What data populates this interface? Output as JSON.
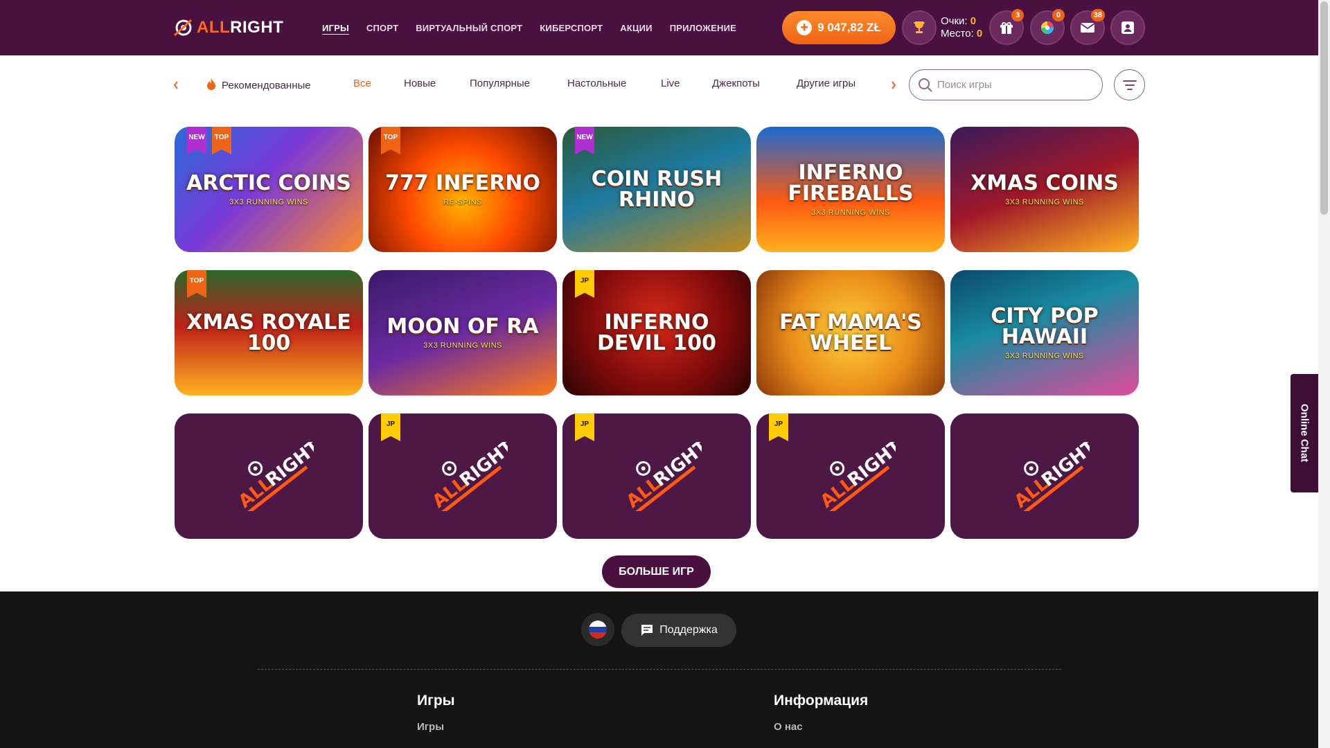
{
  "header": {
    "logo": {
      "part1": "ALL",
      "part2": "RIGHT"
    },
    "nav": [
      "ИГРЫ",
      "СПОРТ",
      "ВИРТУАЛЬНЫЙ СПОРТ",
      "КИБЕРСПОРТ",
      "АКЦИИ",
      "ПРИЛОЖЕНИЕ"
    ],
    "balance": "9 047,82 ZŁ",
    "points_label": "Очки:",
    "points_value": "0",
    "place_label": "Место:",
    "place_value": "0",
    "badges": {
      "gifts": "3",
      "wheel": "0",
      "messages": "38"
    }
  },
  "categories": {
    "items": [
      "Рекомендованные",
      "Все",
      "Новые",
      "Популярные",
      "Настольные",
      "Live",
      "Джекпоты",
      "Другие игры"
    ],
    "active": "Все",
    "search_placeholder": "Поиск игры"
  },
  "games": [
    {
      "title": "Arctic Coins",
      "subtitle": "3X3 RUNNING WINS",
      "tags": [
        "NEW",
        "TOP"
      ]
    },
    {
      "title": "777 Inferno",
      "subtitle": "RE-SPINS",
      "tags": [
        "TOP"
      ]
    },
    {
      "title": "Coin Rush Rhino",
      "subtitle": "",
      "tags": [
        "NEW"
      ]
    },
    {
      "title": "Inferno Fireballs",
      "subtitle": "3X3 RUNNING WINS",
      "tags": []
    },
    {
      "title": "Xmas Coins",
      "subtitle": "3X3 RUNNING WINS",
      "tags": []
    },
    {
      "title": "Xmas Royale 100",
      "subtitle": "",
      "tags": [
        "TOP"
      ]
    },
    {
      "title": "Moon of Ra",
      "subtitle": "3X3 RUNNING WINS",
      "tags": []
    },
    {
      "title": "Inferno Devil 100",
      "subtitle": "",
      "tags": [
        "JP"
      ]
    },
    {
      "title": "Fat Mama's Wheel",
      "subtitle": "",
      "tags": []
    },
    {
      "title": "City Pop Hawaii",
      "subtitle": "3X3 RUNNING WINS",
      "tags": []
    },
    {
      "title": "ALLRIGHT",
      "subtitle": "",
      "tags": []
    },
    {
      "title": "ALLRIGHT",
      "subtitle": "",
      "tags": [
        "JP"
      ]
    },
    {
      "title": "ALLRIGHT",
      "subtitle": "",
      "tags": [
        "JP"
      ]
    },
    {
      "title": "ALLRIGHT",
      "subtitle": "",
      "tags": [
        "JP"
      ]
    },
    {
      "title": "ALLRIGHT",
      "subtitle": "",
      "tags": []
    }
  ],
  "more_button": "БОЛЬШЕ ИГР",
  "footer": {
    "support": "Поддержка",
    "col1_title": "Игры",
    "col1_link": "Игры",
    "col2_title": "Информация",
    "col2_link": "О нас"
  },
  "online_chat": "Online Chat",
  "colors": {
    "brand": "#4a1040",
    "accent": "#f06416",
    "jp": "#ffcc00",
    "new": "#b02fd0"
  }
}
